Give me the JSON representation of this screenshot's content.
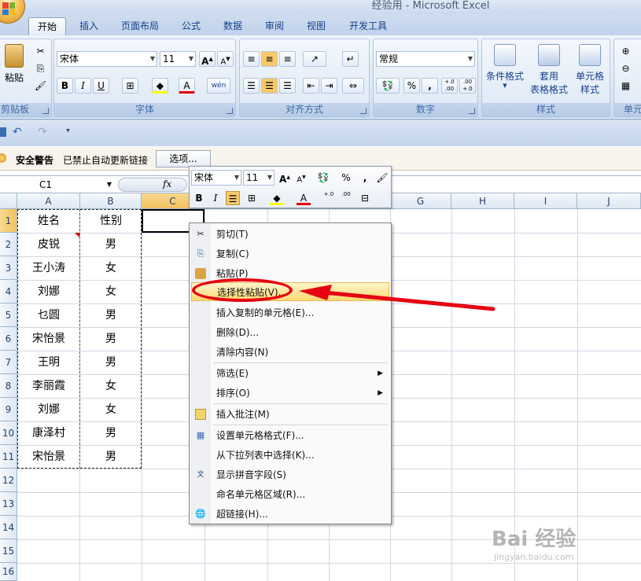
{
  "window": {
    "title": "经验用 - Microsoft Excel"
  },
  "tabs": [
    "开始",
    "插入",
    "页面布局",
    "公式",
    "数据",
    "审阅",
    "视图",
    "开发工具"
  ],
  "ribbon": {
    "clipboard": {
      "label": "剪贴板",
      "paste": "粘贴"
    },
    "font": {
      "label": "字体",
      "name": "宋体",
      "size": "11",
      "bold": "B",
      "italic": "I",
      "underline": "U",
      "font_color": "A",
      "phonetic": "wén"
    },
    "alignment": {
      "label": "对齐方式"
    },
    "number": {
      "label": "数字",
      "format": "常规",
      "percent": "%",
      "comma": ",",
      "inc_decimal": "+.0 .00",
      "dec_decimal": ".00 +.0"
    },
    "styles": {
      "label": "样式",
      "conditional": "条件格式",
      "table_format_line1": "套用",
      "table_format_line2": "表格格式",
      "cell_style_line1": "单元格",
      "cell_style_line2": "样式"
    },
    "cells": {
      "label": "单元"
    }
  },
  "security_bar": {
    "warning": "安全警告",
    "message": "已禁止自动更新链接",
    "options": "选项..."
  },
  "formula_bar": {
    "name_box": "C1",
    "fx": "fx"
  },
  "columns": [
    "A",
    "B",
    "C",
    "D",
    "E",
    "F",
    "G",
    "H",
    "I",
    "J"
  ],
  "rows": [
    "1",
    "2",
    "3",
    "4",
    "5",
    "6",
    "7",
    "8",
    "9",
    "10",
    "11",
    "12",
    "13",
    "14",
    "15",
    "16"
  ],
  "table": {
    "headers": [
      "姓名",
      "性别"
    ],
    "data": [
      [
        "皮锐",
        "男"
      ],
      [
        "王小涛",
        "女"
      ],
      [
        "刘娜",
        "女"
      ],
      [
        "乜圆",
        "男"
      ],
      [
        "宋怡景",
        "男"
      ],
      [
        "王明",
        "男"
      ],
      [
        "李丽霞",
        "女"
      ],
      [
        "刘娜",
        "女"
      ],
      [
        "康泽村",
        "男"
      ],
      [
        "宋怡景",
        "男"
      ]
    ]
  },
  "mini_toolbar": {
    "font": "宋体",
    "size": "11",
    "percent": "%",
    "comma": ","
  },
  "context_menu": [
    "剪切(T)",
    "复制(C)",
    "粘贴(P)",
    "选择性粘贴(V)...",
    "插入复制的单元格(E)...",
    "删除(D)...",
    "清除内容(N)",
    "筛选(E)",
    "排序(O)",
    "插入批注(M)",
    "设置单元格格式(F)...",
    "从下拉列表中选择(K)...",
    "显示拼音字段(S)",
    "命名单元格区域(R)...",
    "超链接(H)..."
  ],
  "watermark": {
    "brand": "Bai 经验",
    "url": "jingyan.baidu.com"
  },
  "colors": {
    "annotation_red": "#e60012",
    "menu_highlight": "#ffd970",
    "ribbon_blue": "#15428b"
  },
  "icons": [
    "cut-icon",
    "copy-icon",
    "paste-icon",
    "comment-icon",
    "format-cells-icon",
    "phonetic-icon",
    "hyperlink-icon"
  ]
}
